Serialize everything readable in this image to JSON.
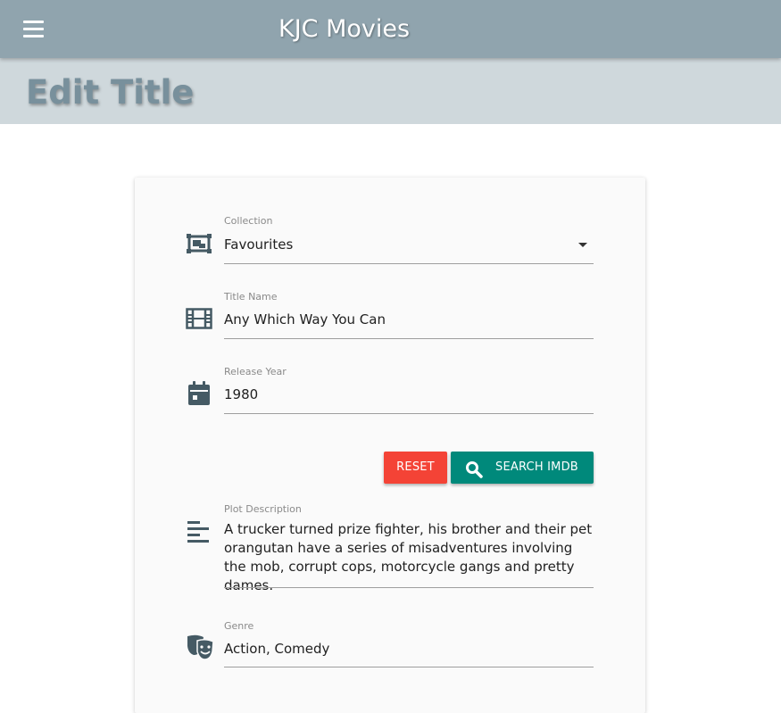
{
  "app": {
    "title": "KJC Movies"
  },
  "page": {
    "title": "Edit Title"
  },
  "form": {
    "collection": {
      "label": "Collection",
      "value": "Favourites",
      "icon": "collection-icon"
    },
    "title_name": {
      "label": "Title Name",
      "value": "Any Which Way You Can",
      "icon": "film-icon"
    },
    "release_year": {
      "label": "Release Year",
      "value": "1980",
      "icon": "calendar-icon"
    },
    "plot": {
      "label": "Plot Description",
      "value": "A trucker turned prize fighter, his brother and their pet orangutan have a series of misadventures involving the mob, corrupt cops, motorcycle gangs and pretty dames.",
      "icon": "text-align-left-icon"
    },
    "genre": {
      "label": "Genre",
      "value": "Action, Comedy",
      "icon": "theater-masks-icon"
    }
  },
  "buttons": {
    "reset_label": "RESET",
    "search_label": "SEARCH IMDB",
    "search_icon": "search-icon"
  },
  "colors": {
    "appbar": "#90a4ae",
    "page_header": "#cfd8dc",
    "icon": "#455a64",
    "reset": "#f44336",
    "search": "#00897b"
  }
}
